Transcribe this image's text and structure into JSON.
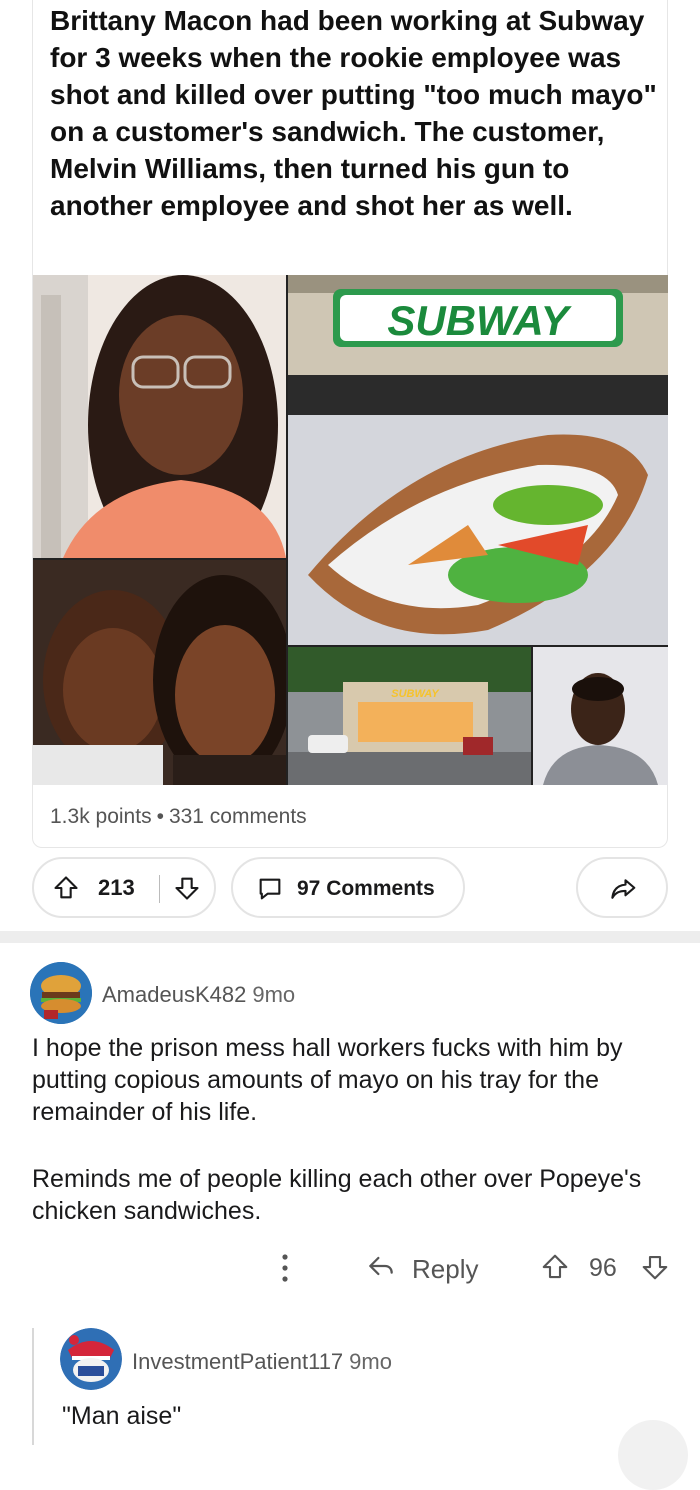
{
  "post": {
    "title": "Brittany Macon had been working at Subway for 3 weeks when the rookie employee was shot and killed over putting \"too much mayo\" on a customer's sandwich. The customer, Melvin Williams, then turned his gun to another employee and shot her as well.",
    "points": "1.3k points",
    "comments_count": "331 comments",
    "separator": "•"
  },
  "collage": {
    "sign_text": "SUBWAY",
    "store_sign_text": "SUBWAY"
  },
  "actions": {
    "upvotes": "213",
    "comments_label": "97 Comments"
  },
  "comments": [
    {
      "username": "AmadeusK482",
      "age": "9mo",
      "body": [
        "I hope the prison mess hall workers fucks with him by putting copious amounts of mayo on his tray for the remainder of his life.",
        "Reminds me of people killing each other over Popeye's chicken sandwiches."
      ],
      "reply_label": "Reply",
      "score": "96"
    },
    {
      "username": "InvestmentPatient117",
      "age": "9mo",
      "body": [
        "\"Man aise\""
      ]
    }
  ],
  "colors": {
    "text": "#1a1a1b",
    "muted": "#555555",
    "border": "#e4e4e4",
    "subway_green": "#1b8a3c",
    "subway_yellow": "#f6c32a"
  },
  "icons": [
    "upvote-icon",
    "downvote-icon",
    "comment-icon",
    "share-icon",
    "more-icon",
    "reply-icon"
  ]
}
